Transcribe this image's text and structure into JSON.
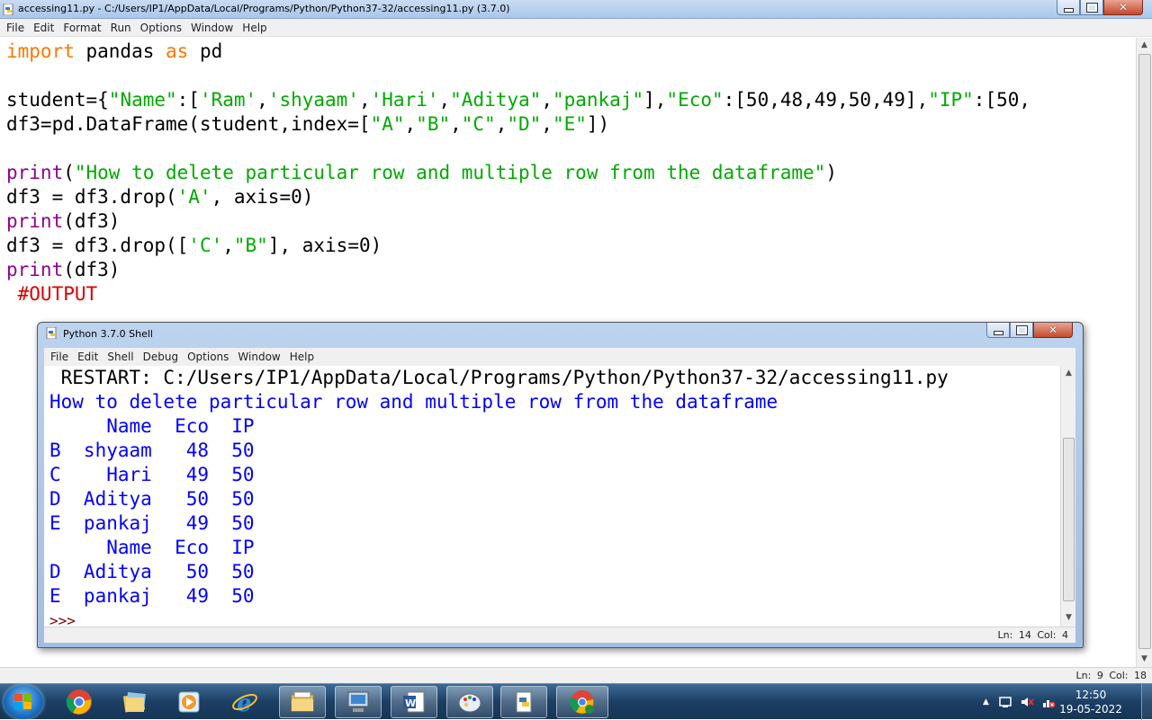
{
  "editor": {
    "title": "accessing11.py - C:/Users/IP1/AppData/Local/Programs/Python/Python37-32/accessing11.py (3.7.0)",
    "menu": [
      "File",
      "Edit",
      "Format",
      "Run",
      "Options",
      "Window",
      "Help"
    ],
    "code": {
      "l1_kw1": "import",
      "l1_mod": " pandas ",
      "l1_kw2": "as",
      "l1_alias": " pd",
      "l3_a": "student={",
      "l3_s1": "\"Name\"",
      "l3_b": ":[",
      "l3_s2": "'Ram'",
      "l3_s3": "'shyaam'",
      "l3_s4": "'Hari'",
      "l3_s5": "\"Aditya\"",
      "l3_s6": "\"pankaj\"",
      "l3_c": "],",
      "l3_s7": "\"Eco\"",
      "l3_d": ":[50,48,49,50,49],",
      "l3_s8": "\"IP\"",
      "l3_e": ":[50,",
      "comma": ",",
      "l4_a": "df3=pd.DataFrame(student,index=[",
      "l4_s1": "\"A\"",
      "l4_s2": "\"B\"",
      "l4_s3": "\"C\"",
      "l4_s4": "\"D\"",
      "l4_s5": "\"E\"",
      "l4_b": "])",
      "print": "print",
      "l6_open": "(",
      "l6_str": "\"How to delete particular row and multiple row from the dataframe\"",
      "l6_close": ")",
      "l7_a": "df3 = df3.drop(",
      "l7_s": "'A'",
      "l7_b": ", axis=0)",
      "l8_arg": "(df3)",
      "l9_a": "df3 = df3.drop([",
      "l9_s1": "'C'",
      "l9_s2": "\"B\"",
      "l9_b": "], axis=0)",
      "l10_arg": "(df3)",
      "l11": " #OUTPUT"
    },
    "status": "Ln: 9   Col: 18"
  },
  "shell": {
    "title": "Python 3.7.0 Shell",
    "menu": [
      "File",
      "Edit",
      "Shell",
      "Debug",
      "Options",
      "Window",
      "Help"
    ],
    "lines": [
      " RESTART: C:/Users/IP1/AppData/Local/Programs/Python/Python37-32/accessing11.py",
      "How to delete particular row and multiple row from the dataframe",
      "     Name  Eco  IP",
      "B  shyaam   48  50",
      "C    Hari   49  50",
      "D  Aditya   50  50",
      "E  pankaj   49  50",
      "     Name  Eco  IP",
      "D  Aditya   50  50",
      "E  pankaj   49  50"
    ],
    "prompt": ">>>",
    "status": "Ln: 14   Col: 4"
  },
  "taskbar": {
    "time": "12:50",
    "date": "19-05-2022"
  }
}
